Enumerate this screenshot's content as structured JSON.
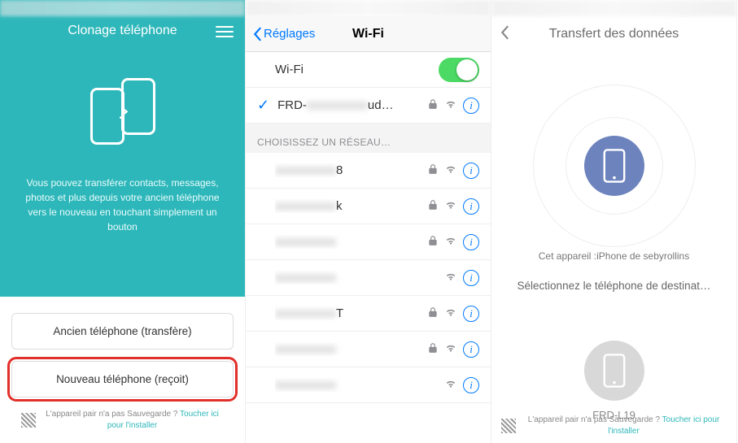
{
  "screen1": {
    "title": "Clonage téléphone",
    "description": "Vous pouvez transférer contacts, messages, photos et plus depuis votre ancien téléphone vers le nouveau en touchant simplement un bouton",
    "btn_old": "Ancien téléphone (transfère)",
    "btn_new": "Nouveau téléphone (reçoit)",
    "footnote_text": "L'appareil pair n'a pas Sauvegarde ?",
    "footnote_link": "Toucher ici pour l'installer"
  },
  "screen2": {
    "back": "Réglages",
    "title": "Wi-Fi",
    "wifi_label": "Wi-Fi",
    "connected_prefix": "FRD-",
    "connected_suffix": "ud…",
    "section_header": "CHOISISSEZ UN RÉSEAU…",
    "networks": [
      {
        "ssid_vis_suffix": "8",
        "locked": true
      },
      {
        "ssid_vis_suffix": "k",
        "locked": true
      },
      {
        "ssid_vis_suffix": "",
        "locked": true
      },
      {
        "ssid_vis_suffix": "",
        "locked": false
      },
      {
        "ssid_vis_suffix": "T",
        "locked": true
      },
      {
        "ssid_vis_suffix": "",
        "locked": true
      },
      {
        "ssid_vis_suffix": "",
        "locked": false
      }
    ]
  },
  "screen3": {
    "title": "Transfert des données",
    "this_device": "Cet appareil :iPhone de sebyrollins",
    "select_prompt": "Sélectionnez le téléphone de destinat…",
    "dest_name": "FRD-L19",
    "footnote_text": "L'appareil pair n'a pas Sauvegarde ?",
    "footnote_link": "Toucher ici pour l'installer"
  }
}
